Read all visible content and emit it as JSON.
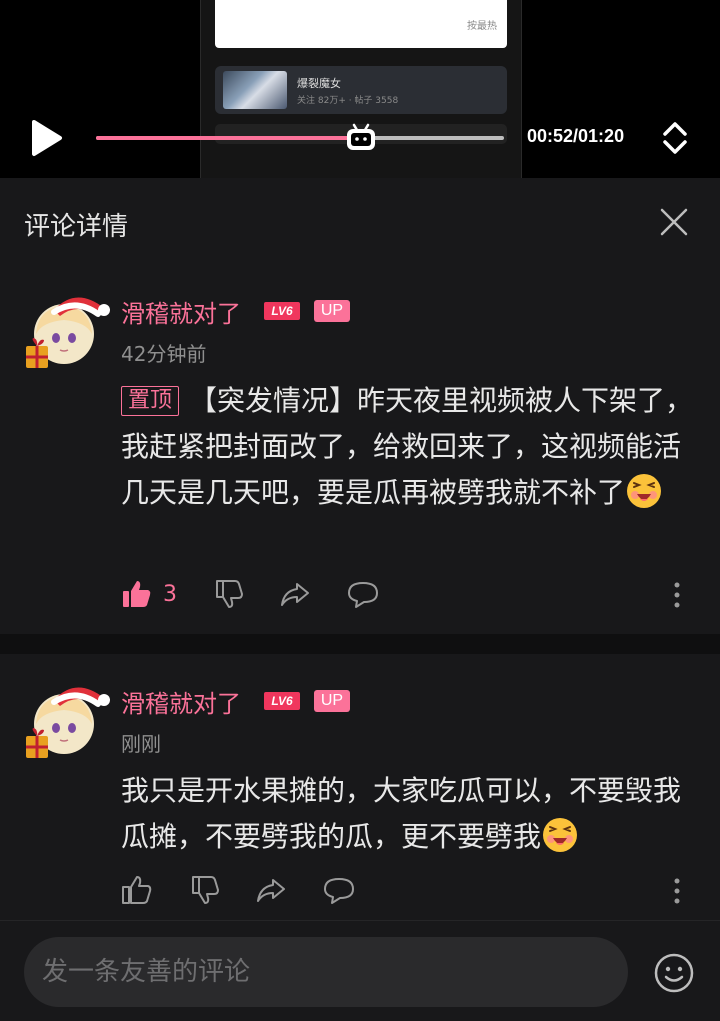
{
  "player": {
    "inner": {
      "sort_label": "按最热",
      "card_title": "爆裂魔女",
      "card_stats": "关注 82万+ · 帖子 3558"
    },
    "current_time": "00:52",
    "total_time": "01:20",
    "time_display": "00:52/01:20",
    "progress_fraction": 0.65
  },
  "panel": {
    "title": "评论详情"
  },
  "comments": [
    {
      "username": "滑稽就对了",
      "level": "LV6",
      "badge": "UP",
      "time": "42分钟前",
      "pin_label": "置顶",
      "text": "【突发情况】昨天夜里视频被人下架了，我赶紧把封面改了，给救回来了，这视频能活几天是几天吧，要是瓜再被劈我就不补了",
      "likes": "3",
      "liked": true
    },
    {
      "username": "滑稽就对了",
      "level": "LV6",
      "badge": "UP",
      "time": "刚刚",
      "text": "我只是开水果摊的，大家吃瓜可以，不要毁我瓜摊，不要劈我的瓜，更不要劈我",
      "likes": "",
      "liked": false
    }
  ],
  "reply": {
    "placeholder": "发一条友善的评论"
  },
  "colors": {
    "accent": "#fb7299",
    "level_badge": "#f0365d",
    "panel_bg": "#18181a"
  },
  "icons": [
    "play-icon",
    "progress-thumb-icon",
    "fullscreen-toggle-icon",
    "close-icon",
    "like-icon",
    "dislike-icon",
    "share-icon",
    "reply-icon",
    "more-icon",
    "emoji-icon"
  ]
}
